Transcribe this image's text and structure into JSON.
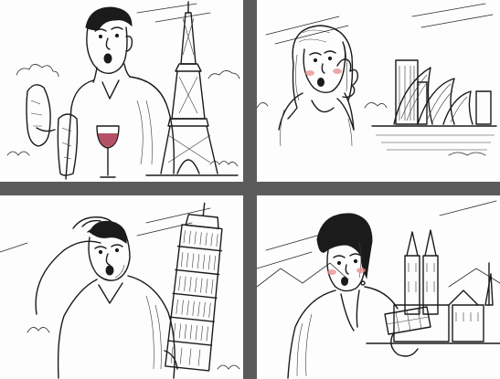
{
  "panels": [
    {
      "id": "p1",
      "landmark": "eiffel-tower",
      "subject": "man-eating-baguette"
    },
    {
      "id": "p2",
      "landmark": "sydney-opera-house",
      "subject": "woman-hand-on-cheek"
    },
    {
      "id": "p3",
      "landmark": "leaning-tower-of-pisa",
      "subject": "man-hand-on-head"
    },
    {
      "id": "p4",
      "landmark": "grossmunster-zurich",
      "subject": "woman-holding-chocolate"
    }
  ],
  "colors": {
    "background": "#5b5b5b",
    "panel": "#fdfdfd",
    "ink": "#1b1b1b",
    "blush": "#e98b8b",
    "wine": "#a8324b"
  }
}
